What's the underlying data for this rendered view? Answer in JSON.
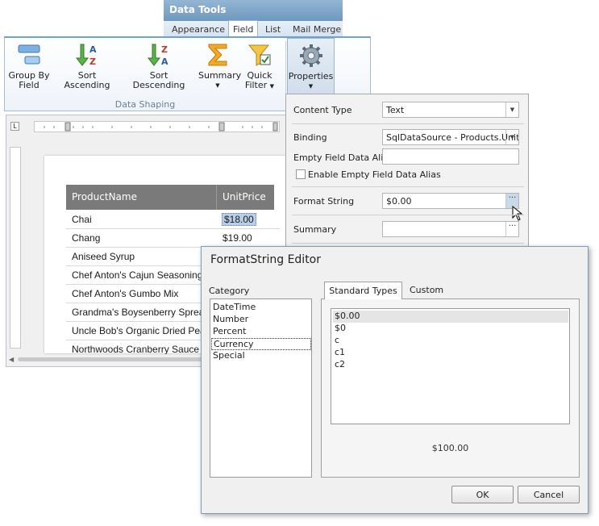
{
  "ribbon": {
    "context_title": "Data Tools",
    "tabs": [
      "Appearance",
      "Field",
      "List",
      "Mail Merge"
    ],
    "active_tab": "Field",
    "buttons": {
      "group_by_field": [
        "Group By",
        "Field"
      ],
      "sort_ascending": "Sort Ascending",
      "sort_descending": "Sort Descending",
      "summary": "Summary",
      "quick_filter": [
        "Quick",
        "Filter"
      ],
      "properties": "Properties"
    },
    "group_label": "Data Shaping"
  },
  "report": {
    "columns": [
      "ProductName",
      "UnitPrice"
    ],
    "rows": [
      {
        "name": "Chai",
        "price": "$18.00"
      },
      {
        "name": "Chang",
        "price": "$19.00"
      },
      {
        "name": "Aniseed Syrup",
        "price": ""
      },
      {
        "name": "Chef Anton's Cajun Seasoning",
        "price": ""
      },
      {
        "name": "Chef Anton's Gumbo Mix",
        "price": ""
      },
      {
        "name": "Grandma's Boysenberry Spread",
        "price": ""
      },
      {
        "name": "Uncle Bob's Organic Dried Pears",
        "price": ""
      },
      {
        "name": "Northwoods Cranberry Sauce",
        "price": ""
      }
    ]
  },
  "properties": {
    "content_type_label": "Content Type",
    "content_type_value": "Text",
    "binding_label": "Binding",
    "binding_value": "SqlDataSource - Products.Unit",
    "empty_alias_label": "Empty Field Data Alias",
    "empty_alias_value": "",
    "enable_alias_label": "Enable Empty Field Data Alias",
    "format_string_label": "Format String",
    "format_string_value": "$0.00",
    "summary_label": "Summary",
    "summary_value": "",
    "ellipsis": "···"
  },
  "dialog": {
    "title": "FormatString Editor",
    "category_label": "Category",
    "categories": [
      "DateTime",
      "Number",
      "Percent",
      "Currency",
      "Special"
    ],
    "selected_category": "Currency",
    "tabs": [
      "Standard Types",
      "Custom"
    ],
    "formats": [
      "$0.00",
      "$0",
      "c",
      "c1",
      "c2"
    ],
    "selected_format": "$0.00",
    "preview": "$100.00",
    "ok_label": "OK",
    "cancel_label": "Cancel"
  },
  "colors": {
    "ribbon_accent": "#6fa2cf",
    "table_header": "#7a7a7a",
    "selection": "#b9cfe8"
  }
}
